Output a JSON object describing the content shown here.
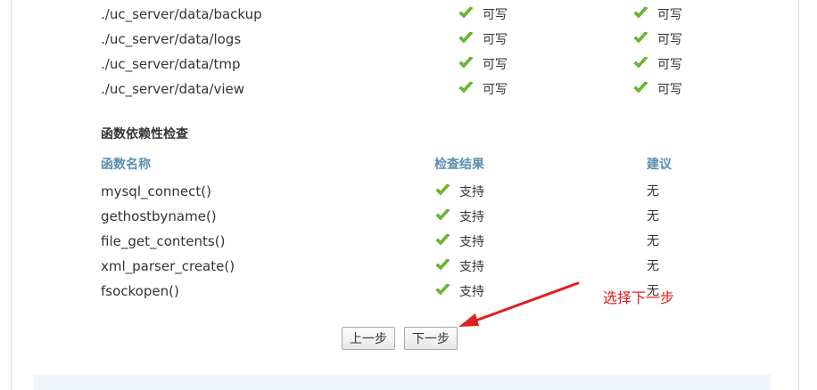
{
  "directory_check": {
    "rows": [
      {
        "path": "./uc_server/data/backup",
        "current": "可写",
        "required": "可写"
      },
      {
        "path": "./uc_server/data/logs",
        "current": "可写",
        "required": "可写"
      },
      {
        "path": "./uc_server/data/tmp",
        "current": "可写",
        "required": "可写"
      },
      {
        "path": "./uc_server/data/view",
        "current": "可写",
        "required": "可写"
      }
    ]
  },
  "function_check": {
    "title": "函数依赖性检查",
    "headers": {
      "name": "函数名称",
      "result": "检查结果",
      "suggestion": "建议"
    },
    "rows": [
      {
        "name": "mysql_connect()",
        "result": "支持",
        "suggestion": "无"
      },
      {
        "name": "gethostbyname()",
        "result": "支持",
        "suggestion": "无"
      },
      {
        "name": "file_get_contents()",
        "result": "支持",
        "suggestion": "无"
      },
      {
        "name": "xml_parser_create()",
        "result": "支持",
        "suggestion": "无"
      },
      {
        "name": "fsockopen()",
        "result": "支持",
        "suggestion": "无"
      }
    ]
  },
  "buttons": {
    "prev_label": "上一步",
    "next_label": "下一步"
  },
  "annotation": {
    "text": "选择下一步",
    "color": "#e02020"
  },
  "colors": {
    "check_green": "#6cbf2a",
    "header_blue": "#5b8fb0",
    "text": "#333333"
  },
  "icons": {
    "status": "check-icon"
  }
}
